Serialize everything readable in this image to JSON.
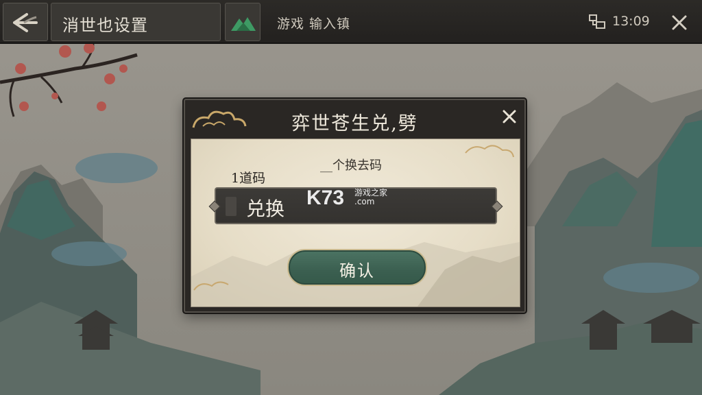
{
  "topbar": {
    "back_icon": "back-arrow-icon",
    "title": "消世也设置",
    "game_icon": "mountain-icon",
    "label": "游戏 输入镇",
    "clock": "13:09",
    "wifi_icon": "network-icon",
    "close_icon": "close-icon"
  },
  "dialog": {
    "title": "弈世苍生兑,劈",
    "close_icon": "close-icon",
    "hint": "__个换去码",
    "field_label": "1道码",
    "input_value": "兑换",
    "confirm_label": "确认"
  },
  "watermark": {
    "logo": "K73",
    "subtitle": "游戏之家",
    "domain": ".com"
  },
  "colors": {
    "topbar": "#2c2a27",
    "dialog_frame": "#2a2724",
    "paper": "#ece4d0",
    "input_bg": "#3a3835",
    "confirm_bg": "#3f6656",
    "confirm_border": "#c9b98e"
  }
}
